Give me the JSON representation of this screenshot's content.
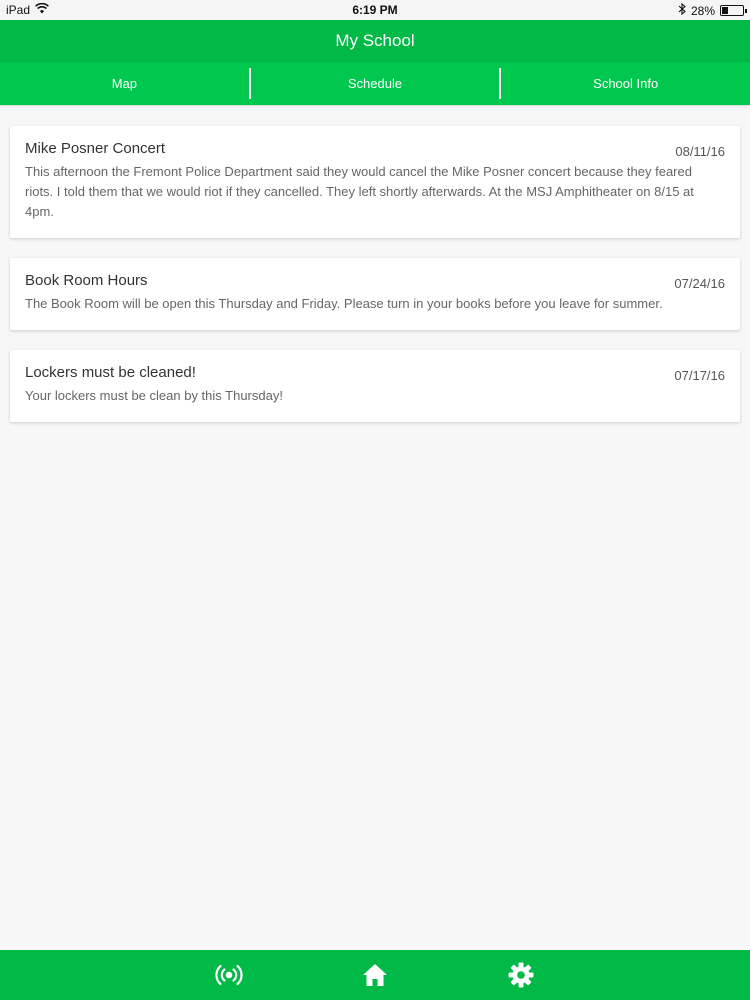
{
  "status": {
    "device": "iPad",
    "time": "6:19 PM",
    "battery": "28%",
    "battery_level": 0.28
  },
  "header": {
    "title": "My School"
  },
  "tabs": [
    {
      "label": "Map"
    },
    {
      "label": "Schedule"
    },
    {
      "label": "School Info"
    }
  ],
  "announcements": [
    {
      "title": "Mike Posner Concert",
      "date": "08/11/16",
      "body": "This afternoon the Fremont Police Department said they would cancel the Mike Posner concert because they feared riots. I told them that we would riot if they cancelled. They left shortly afterwards. At the MSJ Amphitheater on 8/15 at 4pm."
    },
    {
      "title": "Book Room Hours",
      "date": "07/24/16",
      "body": "The Book Room will be open this Thursday and Friday. Please turn in your books before you leave for summer."
    },
    {
      "title": "Lockers must be cleaned!",
      "date": "07/17/16",
      "body": "Your lockers must be clean by this Thursday!"
    }
  ],
  "bottom_nav": [
    {
      "icon": "broadcast-icon"
    },
    {
      "icon": "home-icon"
    },
    {
      "icon": "gear-icon"
    }
  ],
  "colors": {
    "primary": "#00b946",
    "tab_bar": "#00c84f",
    "background": "#f7f7f7"
  }
}
